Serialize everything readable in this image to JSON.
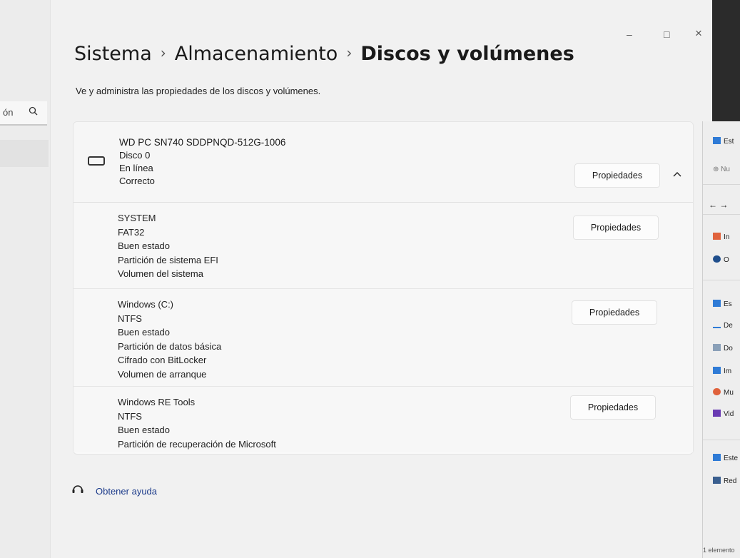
{
  "nav": {
    "search_fragment": "ón",
    "search_icon": "search-icon"
  },
  "window_controls": {
    "minimize": "–",
    "maximize": "□",
    "close": "×"
  },
  "breadcrumb": {
    "items": [
      "Sistema",
      "Almacenamiento",
      "Discos y volúmenes"
    ],
    "separator": "›"
  },
  "subtitle": "Ve y administra las propiedades de los discos y volúmenes.",
  "disk": {
    "name": "WD PC SN740 SDDPNQD-512G-1006",
    "number": "Disco 0",
    "status": "En línea",
    "health": "Correcto",
    "properties_label": "Propiedades",
    "chevron": "^"
  },
  "volumes": [
    {
      "lines": [
        "SYSTEM",
        "FAT32",
        "Buen estado",
        "Partición de sistema EFI",
        "Volumen del sistema"
      ],
      "properties_label": "Propiedades"
    },
    {
      "lines": [
        "Windows  (C:)",
        "NTFS",
        "Buen estado",
        "Partición de datos básica",
        "Cifrado con BitLocker",
        "Volumen de arranque"
      ],
      "properties_label": "Propiedades"
    },
    {
      "lines": [
        "Windows RE Tools",
        "NTFS",
        "Buen estado",
        "Partición de recuperación de Microsoft"
      ],
      "properties_label": "Propiedades"
    }
  ],
  "help": {
    "label": "Obtener ayuda"
  },
  "explorer": {
    "items": [
      "Est",
      "Nu",
      "In",
      "O",
      "Es",
      "De",
      "Do",
      "Im",
      "Mu",
      "Vid",
      "Este",
      "Red"
    ],
    "status": "1 elemento",
    "colors": {
      "blue": "#2f7bd6",
      "download": "#2f7bd6",
      "music": "#e0623c",
      "video": "#6a3bb3",
      "home": "#e0623c",
      "cloud": "#1f4e8c"
    }
  }
}
